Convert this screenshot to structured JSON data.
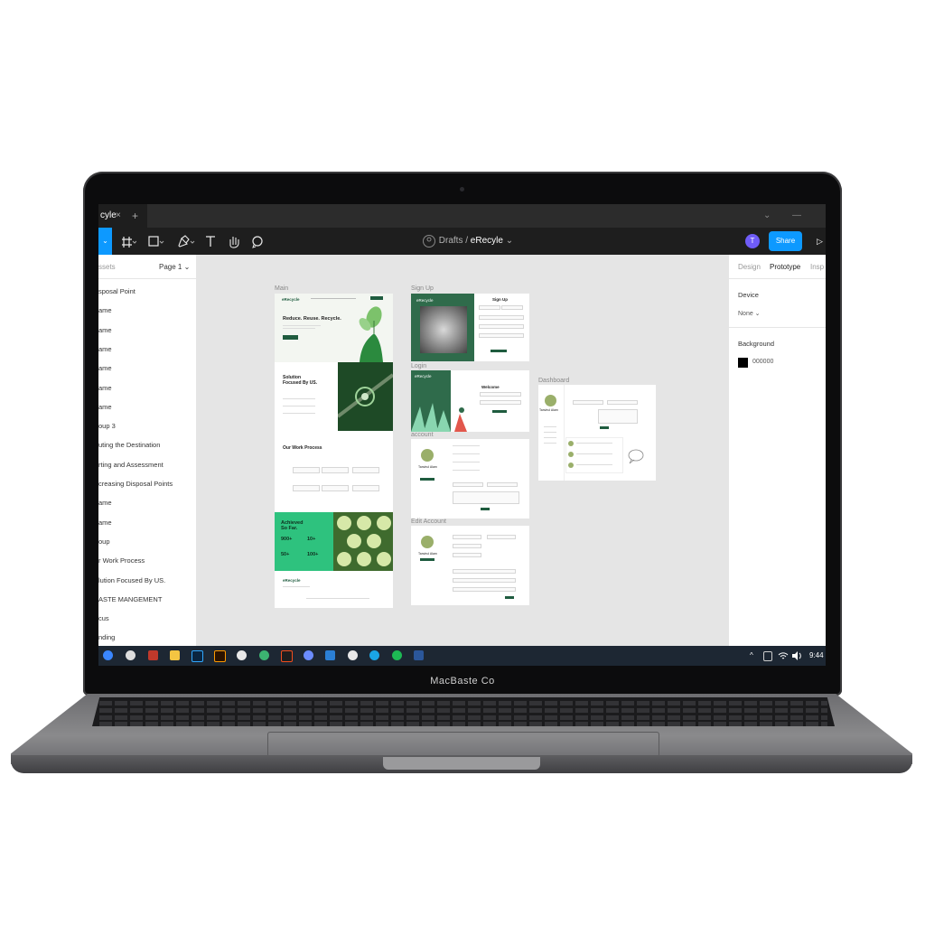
{
  "titlebar": {
    "tab_label": "cyle",
    "close": "×",
    "new_tab": "+",
    "chevron": "⌄",
    "minimize": "—"
  },
  "toolbar": {
    "breadcrumb_root": "Drafts",
    "separator": "/",
    "file_name": "eRecyle",
    "file_chevron": "⌄",
    "avatar_initial": "T",
    "share_label": "Share",
    "play": "▷"
  },
  "left_panel": {
    "assets_tab": "ssets",
    "page_label": "Page 1 ⌄",
    "layers": [
      "sposal Point",
      "ame",
      "ame",
      "ame",
      "ame",
      "ame",
      "ame",
      "oup 3",
      "uting the Destination",
      "rting and Assessment",
      "creasing Disposal Points",
      "ame",
      "ame",
      "oup",
      "r Work Process",
      "lution Focused By US.",
      "ASTE MANGEMENT",
      "cus",
      "nding"
    ]
  },
  "right_panel": {
    "tabs": [
      "Design",
      "Prototype",
      "Insp"
    ],
    "device_label": "Device",
    "device_value": "None ⌄",
    "background_label": "Background",
    "background_value": "000000",
    "background_color": "#000000"
  },
  "canvas": {
    "frame_labels": {
      "main": "Main",
      "signup": "Sign Up",
      "login": "Login",
      "dashboard": "Dashboard",
      "account": "account",
      "edit_account": "Edit Account"
    },
    "main": {
      "nav_logo": "eRecycle",
      "hero_title": "Reduce. Reuse. Recycle.",
      "solution_title": "Solution Focused By US.",
      "process_title": "Our Work Process",
      "achieved_title": "Achieved So Far.",
      "stat_a": "900+",
      "stat_b": "10+",
      "stat_c": "50+",
      "stat_d": "100+",
      "footer_logo": "eRecycle"
    },
    "signup": {
      "logo": "eRecycle",
      "title": "Sign Up"
    },
    "login": {
      "logo": "eRecycle",
      "title": "Welcome"
    },
    "dashboard": {
      "user_name": "Tanvirul Alam"
    },
    "account": {
      "user_name": "Tanvirul Alam"
    },
    "edit_account": {
      "user_name": "Tanvirul Alam"
    }
  },
  "taskbar": {
    "tray_caret": "^",
    "clock": "9:44"
  },
  "laptop": {
    "brand": "MacBaste Co"
  },
  "colors": {
    "accent": "#0d99ff",
    "brand_green": "#1f5c3f",
    "bright_green": "#2ec27e"
  }
}
